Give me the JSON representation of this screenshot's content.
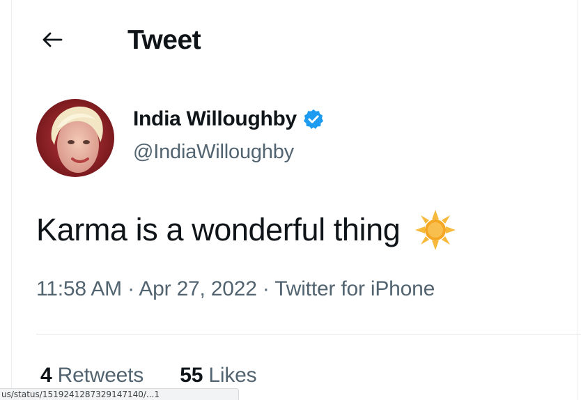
{
  "header": {
    "title": "Tweet",
    "back_icon": "arrow-left-icon"
  },
  "author": {
    "display_name": "India Willoughby",
    "handle": "@IndiaWilloughby",
    "verified_icon": "verified-badge-icon",
    "avatar_icon": "profile-photo"
  },
  "tweet": {
    "text": "Karma is a wonderful thing",
    "emoji_icon": "sun-emoji-icon"
  },
  "meta": {
    "time": "11:58 AM",
    "separator": " · ",
    "date": "Apr 27, 2022",
    "source": "Twitter for iPhone"
  },
  "stats": {
    "retweets_count": "4",
    "retweets_label": "Retweets",
    "likes_count": "55",
    "likes_label": "Likes"
  },
  "browser_status": {
    "url": "us/status/1519241287329147140/...1"
  },
  "colors": {
    "primary_text": "#0f1419",
    "secondary_text": "#536471",
    "verified_blue": "#1d9bf0",
    "divider": "#e3e6e9"
  }
}
